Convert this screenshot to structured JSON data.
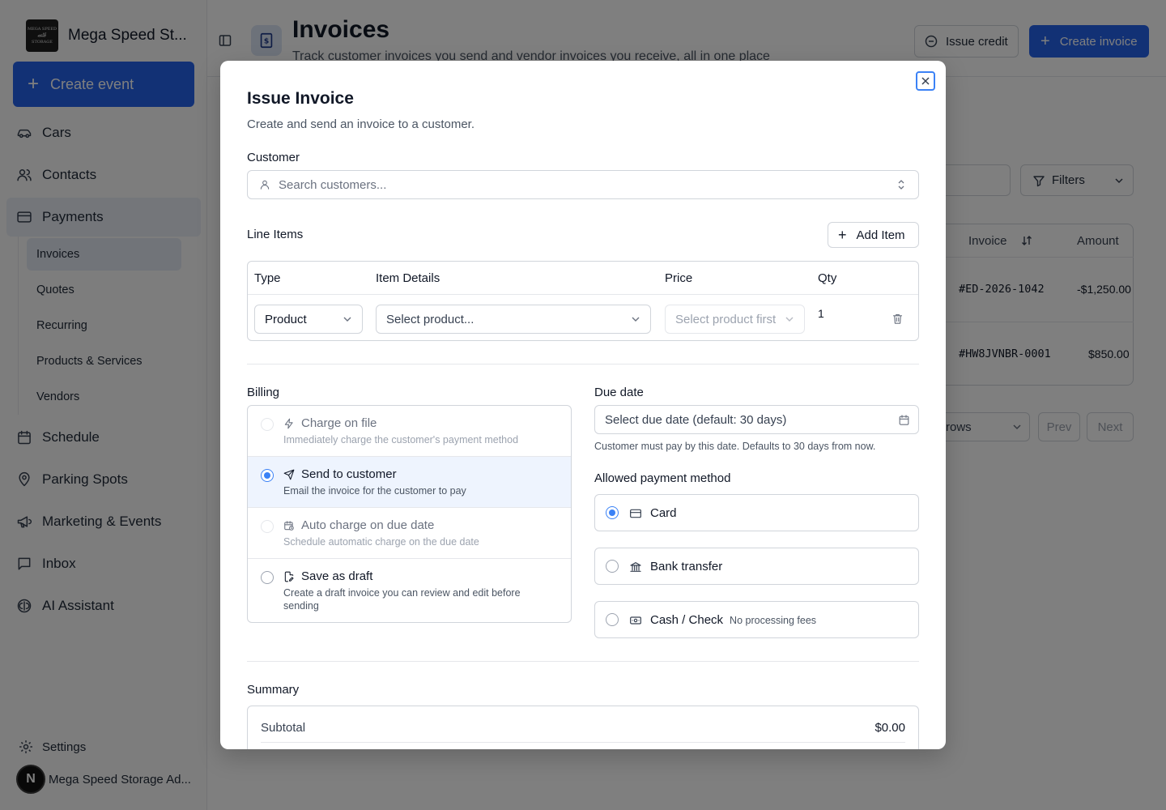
{
  "sidebar": {
    "brand_name": "Mega Speed St...",
    "logo_text": [
      "MEGA SPEED",
      "STORAGE"
    ],
    "create_event": "Create event",
    "nav": [
      {
        "label": "Cars",
        "icon": "car-icon"
      },
      {
        "label": "Contacts",
        "icon": "users-icon"
      },
      {
        "label": "Payments",
        "icon": "credit-card-icon",
        "active": true
      },
      {
        "label": "Schedule",
        "icon": "calendar-icon"
      },
      {
        "label": "Parking Spots",
        "icon": "map-pin-icon"
      },
      {
        "label": "Marketing & Events",
        "icon": "megaphone-icon"
      },
      {
        "label": "Inbox",
        "icon": "message-square-icon"
      },
      {
        "label": "AI Assistant",
        "icon": "brain-icon"
      }
    ],
    "sub_nav": [
      {
        "label": "Invoices",
        "active": true
      },
      {
        "label": "Quotes"
      },
      {
        "label": "Recurring"
      },
      {
        "label": "Products & Services"
      },
      {
        "label": "Vendors"
      }
    ],
    "settings": "Settings",
    "user_initial": "N",
    "user_name": "Mega Speed Storage Ad..."
  },
  "header": {
    "title": "Invoices",
    "subtitle": "Track customer invoices you send and vendor invoices you receive, all in one place",
    "issue_credit": "Issue credit",
    "create_invoice": "Create invoice"
  },
  "background": {
    "filters": "Filters",
    "columns": [
      "Invoice",
      "Amount"
    ],
    "rows": [
      {
        "invoice": "#ED-2026-1042",
        "amount": "-$1,250.00"
      },
      {
        "invoice": "#HW8JVNBR-0001",
        "amount": "$850.00"
      }
    ],
    "rows_label": "rows",
    "prev": "Prev",
    "next": "Next"
  },
  "modal": {
    "title": "Issue Invoice",
    "description": "Create and send an invoice to a customer.",
    "customer_label": "Customer",
    "customer_placeholder": "Search customers...",
    "line_items_label": "Line Items",
    "add_item": "Add Item",
    "line_columns": [
      "Type",
      "Item Details",
      "Price",
      "Qty"
    ],
    "line_item": {
      "type": "Product",
      "product_placeholder": "Select product...",
      "price_placeholder": "Select product first",
      "qty": "1"
    },
    "billing_label": "Billing",
    "billing_options": [
      {
        "title": "Charge on file",
        "desc": "Immediately charge the customer's payment method",
        "icon": "zap-icon",
        "state": "disabled"
      },
      {
        "title": "Send to customer",
        "desc": "Email the invoice for the customer to pay",
        "icon": "send-icon",
        "state": "selected"
      },
      {
        "title": "Auto charge on due date",
        "desc": "Schedule automatic charge on the due date",
        "icon": "calendar-clock-icon",
        "state": "disabled"
      },
      {
        "title": "Save as draft",
        "desc": "Create a draft invoice you can review and edit before sending",
        "icon": "file-pen-icon",
        "state": "normal"
      }
    ],
    "due_date_label": "Due date",
    "due_date_placeholder": "Select due date (default: 30 days)",
    "due_date_help": "Customer must pay by this date. Defaults to 30 days from now.",
    "payment_method_label": "Allowed payment method",
    "payment_methods": [
      {
        "label": "Card",
        "icon": "credit-card-icon",
        "selected": true,
        "note": ""
      },
      {
        "label": "Bank transfer",
        "icon": "bank-icon",
        "selected": false,
        "note": ""
      },
      {
        "label": "Cash / Check",
        "icon": "banknote-icon",
        "selected": false,
        "note": "No processing fees"
      }
    ],
    "summary_label": "Summary",
    "subtotal_label": "Subtotal",
    "subtotal_value": "$0.00"
  },
  "colors": {
    "primary": "#2563eb",
    "radio_on": "#3b82f6",
    "selected_bg": "#eef4fe"
  }
}
